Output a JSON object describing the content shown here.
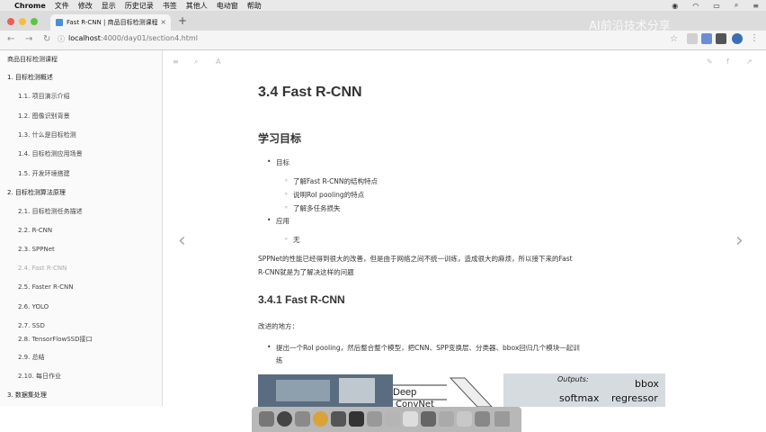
{
  "menubar": {
    "app": "Chrome",
    "items": [
      "文件",
      "修改",
      "显示",
      "历史记录",
      "书签",
      "其他人",
      "电动窗",
      "帮助"
    ]
  },
  "tab": {
    "title": "Fast R-CNN | 商品目标检测课程"
  },
  "address": {
    "host": "localhost",
    "path": ":4000/day01/section4.html"
  },
  "watermark": "AI前沿技术分享",
  "sidebar": {
    "title": "商品目标检测课程",
    "items": [
      {
        "label": "1. 目标检测概述"
      },
      {
        "label": "1.1. 项目演示介绍"
      },
      {
        "label": "1.2. 图像识别背景"
      },
      {
        "label": "1.3. 什么是目标检测"
      },
      {
        "label": "1.4. 目标检测应用场景"
      },
      {
        "label": "1.5. 开发环境搭建"
      },
      {
        "label": "2. 目标检测算法原理"
      },
      {
        "label": "2.1. 目标检测任务描述"
      },
      {
        "label": "2.2. R-CNN"
      },
      {
        "label": "2.3. SPPNet"
      },
      {
        "label": "2.4. Fast R-CNN"
      },
      {
        "label": "2.5. Faster R-CNN"
      },
      {
        "label": "2.6. YOLO"
      },
      {
        "label": "2.7. SSD"
      },
      {
        "label": "2.8. TensorFlowSSD接口"
      },
      {
        "label": "2.9. 总结"
      },
      {
        "label": "2.10. 每日作业"
      },
      {
        "label": "3. 数据集处理"
      }
    ]
  },
  "content": {
    "h1": "3.4 Fast R-CNN",
    "h2": "学习目标",
    "goal_label": "目标",
    "goals": [
      "了解Fast R-CNN的结构特点",
      "说明RoI pooling的特点",
      "了解多任务损失"
    ],
    "app_label": "应用",
    "app_item": "无",
    "para1": "SPPNet的性能已经得到很大的改善，但是由于网络之间不统一训练，造成很大的麻烦，所以接下来的Fast",
    "para2": "R-CNN就是为了解决这样的问题",
    "h3": "3.4.1 Fast R-CNN",
    "improve": "改进的地方：",
    "bullet1": "提出一个RoI pooling，然后整合整个模型，把CNN、SPP变换层、分类器、bbox回归几个模块一起训",
    "bullet1b": "练"
  },
  "figure": {
    "deep": "Deep",
    "convnet": "ConvNet",
    "outputs": "Outputs:",
    "bbox": "bbox",
    "softmax": "softmax",
    "regressor": "regressor"
  }
}
